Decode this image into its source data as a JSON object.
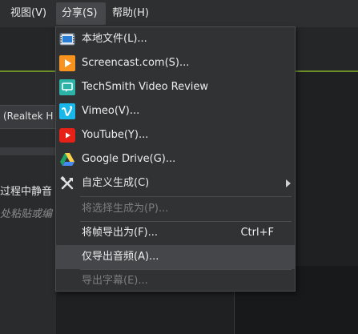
{
  "menubar": {
    "view": "视图(V)",
    "share": "分享(S)",
    "help": "帮助(H)"
  },
  "background": {
    "audio_device_fragment": "(Realtek H",
    "option_text_fragment": "过程中静音",
    "placeholder_fragment": "处粘贴或编"
  },
  "share_menu": {
    "items": [
      {
        "label": "本地文件(L)...",
        "icon": "film-icon",
        "enabled": true
      },
      {
        "label": "Screencast.com(S)...",
        "icon": "screencast-icon",
        "enabled": true
      },
      {
        "label": "TechSmith Video Review",
        "icon": "video-review-icon",
        "enabled": true
      },
      {
        "label": "Vimeo(V)...",
        "icon": "vimeo-icon",
        "enabled": true
      },
      {
        "label": "YouTube(Y)...",
        "icon": "youtube-icon",
        "enabled": true
      },
      {
        "label": "Google Drive(G)...",
        "icon": "google-drive-icon",
        "enabled": true
      },
      {
        "label": "自定义生成(C)",
        "icon": "tools-icon",
        "enabled": true,
        "submenu": true
      },
      {
        "label": "将选择生成为(P)...",
        "enabled": false
      },
      {
        "label": "将帧导出为(F)...",
        "shortcut": "Ctrl+F",
        "enabled": true
      },
      {
        "label": "仅导出音频(A)...",
        "enabled": true,
        "highlighted": true
      },
      {
        "label": "导出字幕(E)...",
        "enabled": false
      }
    ]
  },
  "colors": {
    "screencast_orange": "#f7931e",
    "video_review_teal": "#2bb3a8",
    "vimeo_blue": "#1ab7ea",
    "youtube_red": "#e62117",
    "drive_green": "#1fa463",
    "drive_yellow": "#ffd04b",
    "drive_blue": "#4688f4",
    "accent_green": "#6c8f2a"
  }
}
